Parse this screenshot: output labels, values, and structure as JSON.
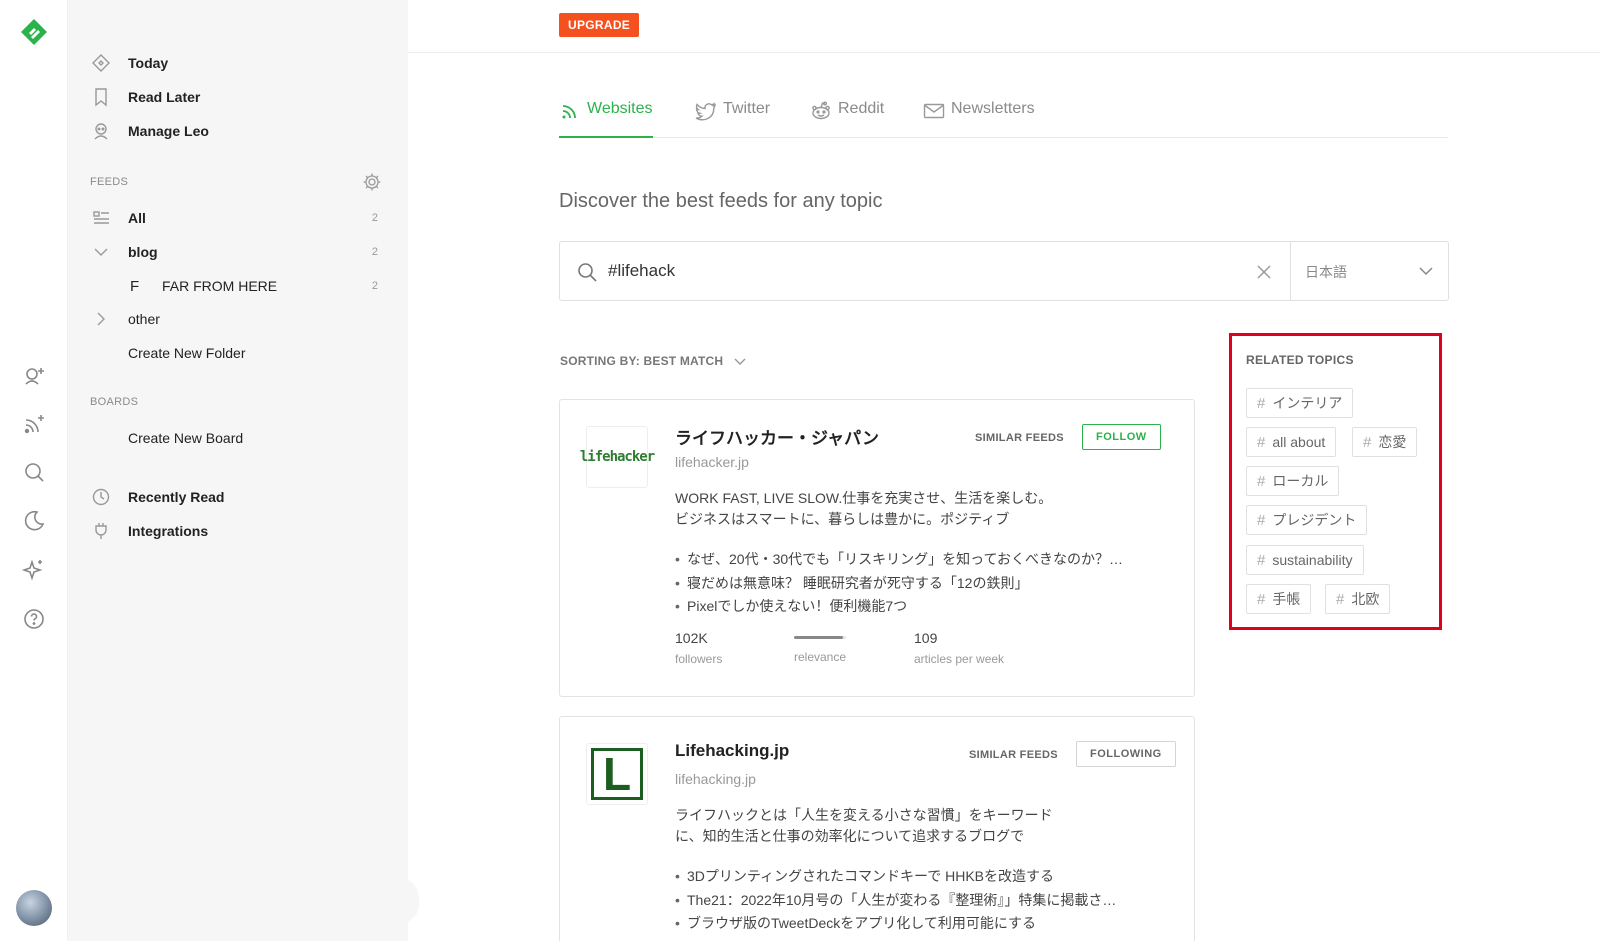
{
  "upgrade_label": "UPGRADE",
  "sidebar": {
    "nav": [
      {
        "label": "Today",
        "icon": "today-icon"
      },
      {
        "label": "Read Later",
        "icon": "bookmark-icon"
      },
      {
        "label": "Manage Leo",
        "icon": "leo-icon"
      }
    ],
    "feeds_heading": "FEEDS",
    "feeds": {
      "all_label": "All",
      "all_count": "2",
      "blog_label": "blog",
      "blog_count": "2",
      "far_letter": "F",
      "far_label": "FAR FROM HERE",
      "far_count": "2",
      "other_label": "other",
      "create_folder": "Create New Folder"
    },
    "boards_heading": "BOARDS",
    "create_board": "Create New Board",
    "recently_read": "Recently Read",
    "integrations": "Integrations"
  },
  "tabs": [
    {
      "label": "Websites",
      "active": true
    },
    {
      "label": "Twitter",
      "active": false
    },
    {
      "label": "Reddit",
      "active": false
    },
    {
      "label": "Newsletters",
      "active": false
    }
  ],
  "discover_heading": "Discover the best feeds for any topic",
  "search": {
    "value": "#lifehack",
    "language": "日本語"
  },
  "sorting_label": "SORTING BY: BEST MATCH",
  "feeds_results": [
    {
      "title": "ライフハッカー・ジャパン",
      "domain": "lifehacker.jp",
      "logo_text": "lifehacker",
      "similar_label": "SIMILAR FEEDS",
      "button_label": "FOLLOW",
      "description": "WORK FAST, LIVE SLOW.仕事を充実させ、生活を楽しむ。ビジネスはスマートに、暮らしは豊かに。ポジティブ",
      "articles": [
        "なぜ、20代・30代でも「リスキリング」を知っておくべきなのか？…",
        "寝だめは無意味？ 睡眠研究者が死守する「12の鉄則」",
        "Pixelでしか使えない！便利機能7つ"
      ],
      "followers": "102K",
      "followers_label": "followers",
      "relevance_label": "relevance",
      "relevance": 0.95,
      "per_week": "109",
      "per_week_label": "articles per week"
    },
    {
      "title": "Lifehacking.jp",
      "domain": "lifehacking.jp",
      "logo_text": "L",
      "similar_label": "SIMILAR FEEDS",
      "button_label": "FOLLOWING",
      "description": "ライフハックとは「人生を変える小さな習慣」をキーワードに、知的生活と仕事の効率化について追求するブログで",
      "articles": [
        "3Dプリンティングされたコマンドキーで HHKBを改造する",
        "The21：2022年10月号の「人生が変わる『整理術』」特集に掲載さ…",
        "ブラウザ版のTweetDeckをアプリ化して利用可能にする"
      ]
    }
  ],
  "related_topics": {
    "title": "RELATED TOPICS",
    "topics": [
      "インテリア",
      "all about",
      "恋愛",
      "ローカル",
      "プレジデント",
      "sustainability",
      "手帳",
      "北欧"
    ]
  },
  "colors": {
    "accent": "#2bb24c",
    "upgrade": "#f4511e",
    "highlight": "#e0001b"
  }
}
